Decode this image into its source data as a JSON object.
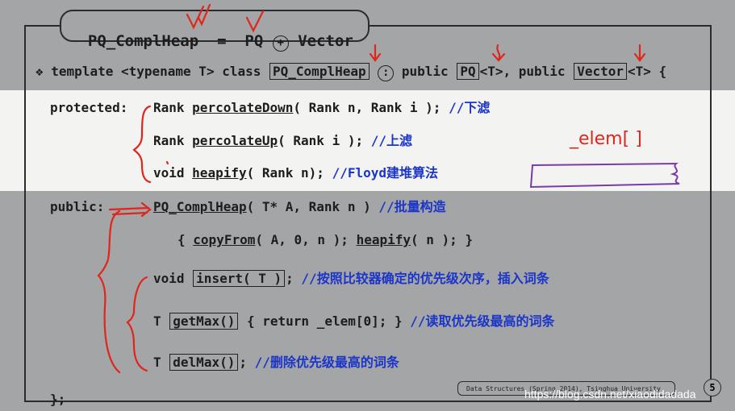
{
  "title": {
    "left": "PQ_ComplHeap",
    "eq": "=",
    "pq": "PQ",
    "plus": "+",
    "vector": "Vector"
  },
  "decl": {
    "bullet": "❖",
    "prefix": "template <typename T> class",
    "cls": "PQ_ComplHeap",
    "colon": ":",
    "public1": "public",
    "pq": "PQ",
    "t1": "<T>, public",
    "vec": "Vector",
    "t2": "<T> {"
  },
  "protected": {
    "label": "protected:",
    "lines": [
      {
        "type": "Rank",
        "name": "percolateDown",
        "args": "( Rank n, Rank i );",
        "comment": "//下滤"
      },
      {
        "type": "Rank",
        "name": "percolateUp",
        "args": "( Rank i );",
        "comment": "//上滤"
      },
      {
        "type": "void",
        "name": "heapify",
        "args": "( Rank n);",
        "comment": "//Floyd建堆算法"
      }
    ]
  },
  "public": {
    "label": "public:",
    "ctor": {
      "name": "PQ_ComplHeap",
      "args": "( T* A, Rank n )",
      "comment": "//批量构造"
    },
    "body": {
      "open": "{",
      "copy": "copyFrom",
      "copy_args": "( A, 0, n );",
      "heap": "heapify",
      "heap_args": "( n ); }"
    },
    "insert": {
      "type": "void",
      "sig": "insert( T )",
      "semi": ";",
      "comment": "//按照比较器确定的优先级次序，插入词条"
    },
    "getmax": {
      "type": "T",
      "sig": "getMax()",
      "body": "{ return _elem[0]; }",
      "comment": "//读取优先级最高的词条"
    },
    "delmax": {
      "type": "T",
      "sig": "delMax()",
      "semi": ";",
      "comment": "//删除优先级最高的词条"
    }
  },
  "closing": "};",
  "handwritten_note": "_elem[ ]",
  "footer": "Data Structures (Spring 2014), Tsinghua University",
  "page_number": "5",
  "watermark": "https://blog.csdn.net/xiaodidadada",
  "colors": {
    "background": "#a4a5a7",
    "highlight_band": "#f3f3f1",
    "comment_blue": "#1b35c8",
    "annotation_red": "#e0261c",
    "annotation_purple": "#7a3aa8"
  }
}
